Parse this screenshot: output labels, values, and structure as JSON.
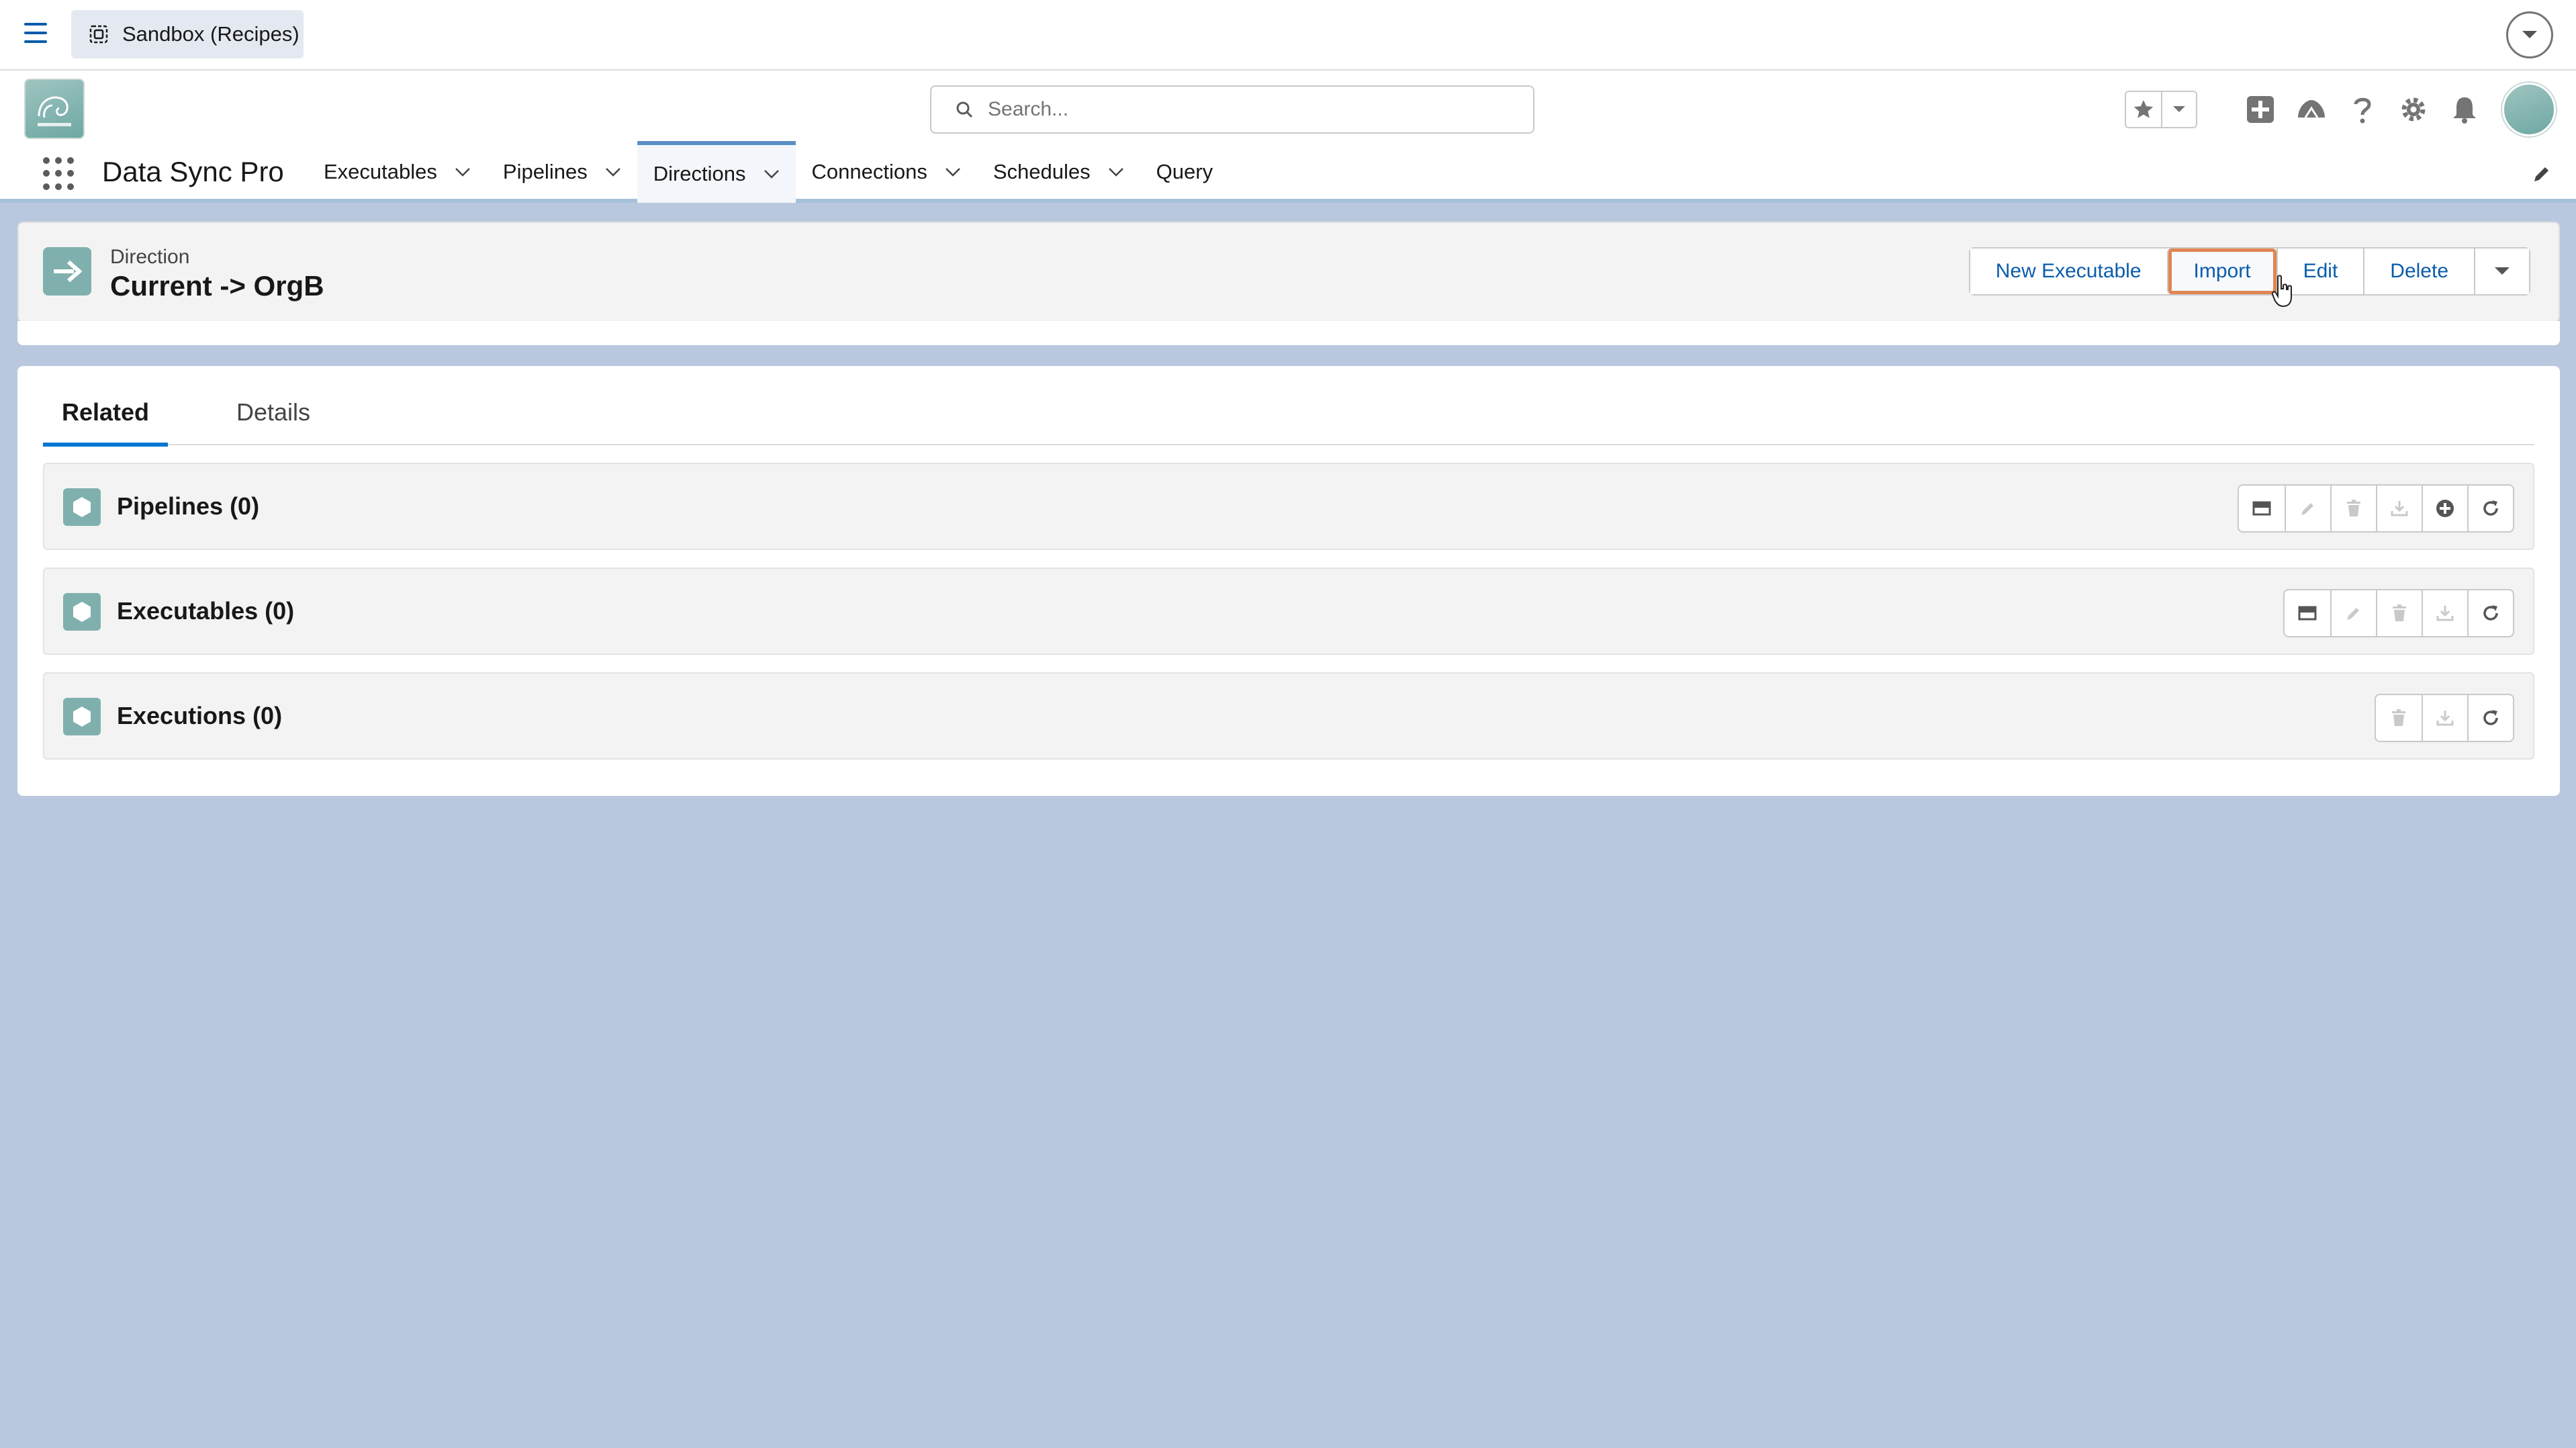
{
  "topbar": {
    "sandbox_label": "Sandbox (Recipes)",
    "icons": [
      "menu-icon",
      "sandbox-icon",
      "chevron-down-icon"
    ]
  },
  "header": {
    "search_placeholder": "Search...",
    "icons": [
      "star-icon",
      "chevron-down-icon",
      "plus-icon",
      "trailhead-icon",
      "help-icon",
      "gear-icon",
      "bell-icon"
    ]
  },
  "app": {
    "name": "Data Sync Pro",
    "nav": [
      {
        "label": "Executables",
        "has_menu": true
      },
      {
        "label": "Pipelines",
        "has_menu": true
      },
      {
        "label": "Directions",
        "has_menu": true,
        "active": true
      },
      {
        "label": "Connections",
        "has_menu": true
      },
      {
        "label": "Schedules",
        "has_menu": true
      },
      {
        "label": "Query",
        "has_menu": false
      }
    ]
  },
  "record": {
    "type": "Direction",
    "title": "Current -> OrgB",
    "actions": {
      "new_executable": "New Executable",
      "import": "Import",
      "edit": "Edit",
      "delete": "Delete"
    }
  },
  "tabs": {
    "related": "Related",
    "details": "Details",
    "active": "Related"
  },
  "related_lists": [
    {
      "title": "Pipelines (0)",
      "actions": [
        "table-icon",
        "pencil-icon",
        "trash-icon",
        "download-icon",
        "add-circle-icon",
        "refresh-icon"
      ]
    },
    {
      "title": "Executables (0)",
      "actions": [
        "table-icon",
        "pencil-icon",
        "trash-icon",
        "download-icon",
        "refresh-icon"
      ]
    },
    {
      "title": "Executions (0)",
      "actions": [
        "trash-icon",
        "download-icon",
        "refresh-icon"
      ]
    }
  ],
  "colors": {
    "brand_blue": "#0176d3",
    "link_blue": "#0b5cab",
    "page_background": "#b9c8de",
    "record_icon": "#7fb0ad",
    "focus_ring": "#e08552"
  }
}
